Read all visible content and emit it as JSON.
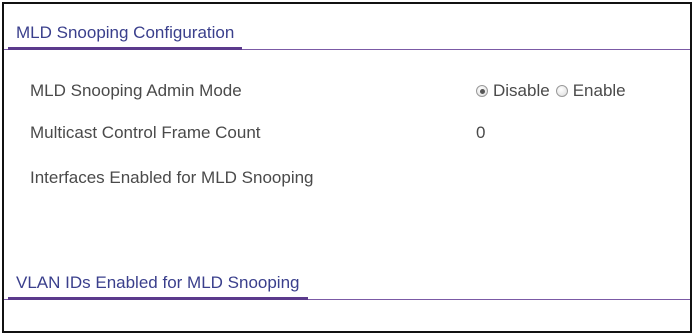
{
  "mld_section": {
    "title": "MLD Snooping Configuration"
  },
  "fields": {
    "admin_mode": {
      "label": "MLD Snooping Admin Mode",
      "options": [
        "Disable",
        "Enable"
      ],
      "selected": "Disable"
    },
    "frame_count": {
      "label": "Multicast Control Frame Count",
      "value": "0"
    },
    "interfaces": {
      "label": "Interfaces Enabled for MLD Snooping",
      "value": ""
    }
  },
  "vlan_section": {
    "title": "VLAN IDs Enabled for MLD Snooping"
  }
}
